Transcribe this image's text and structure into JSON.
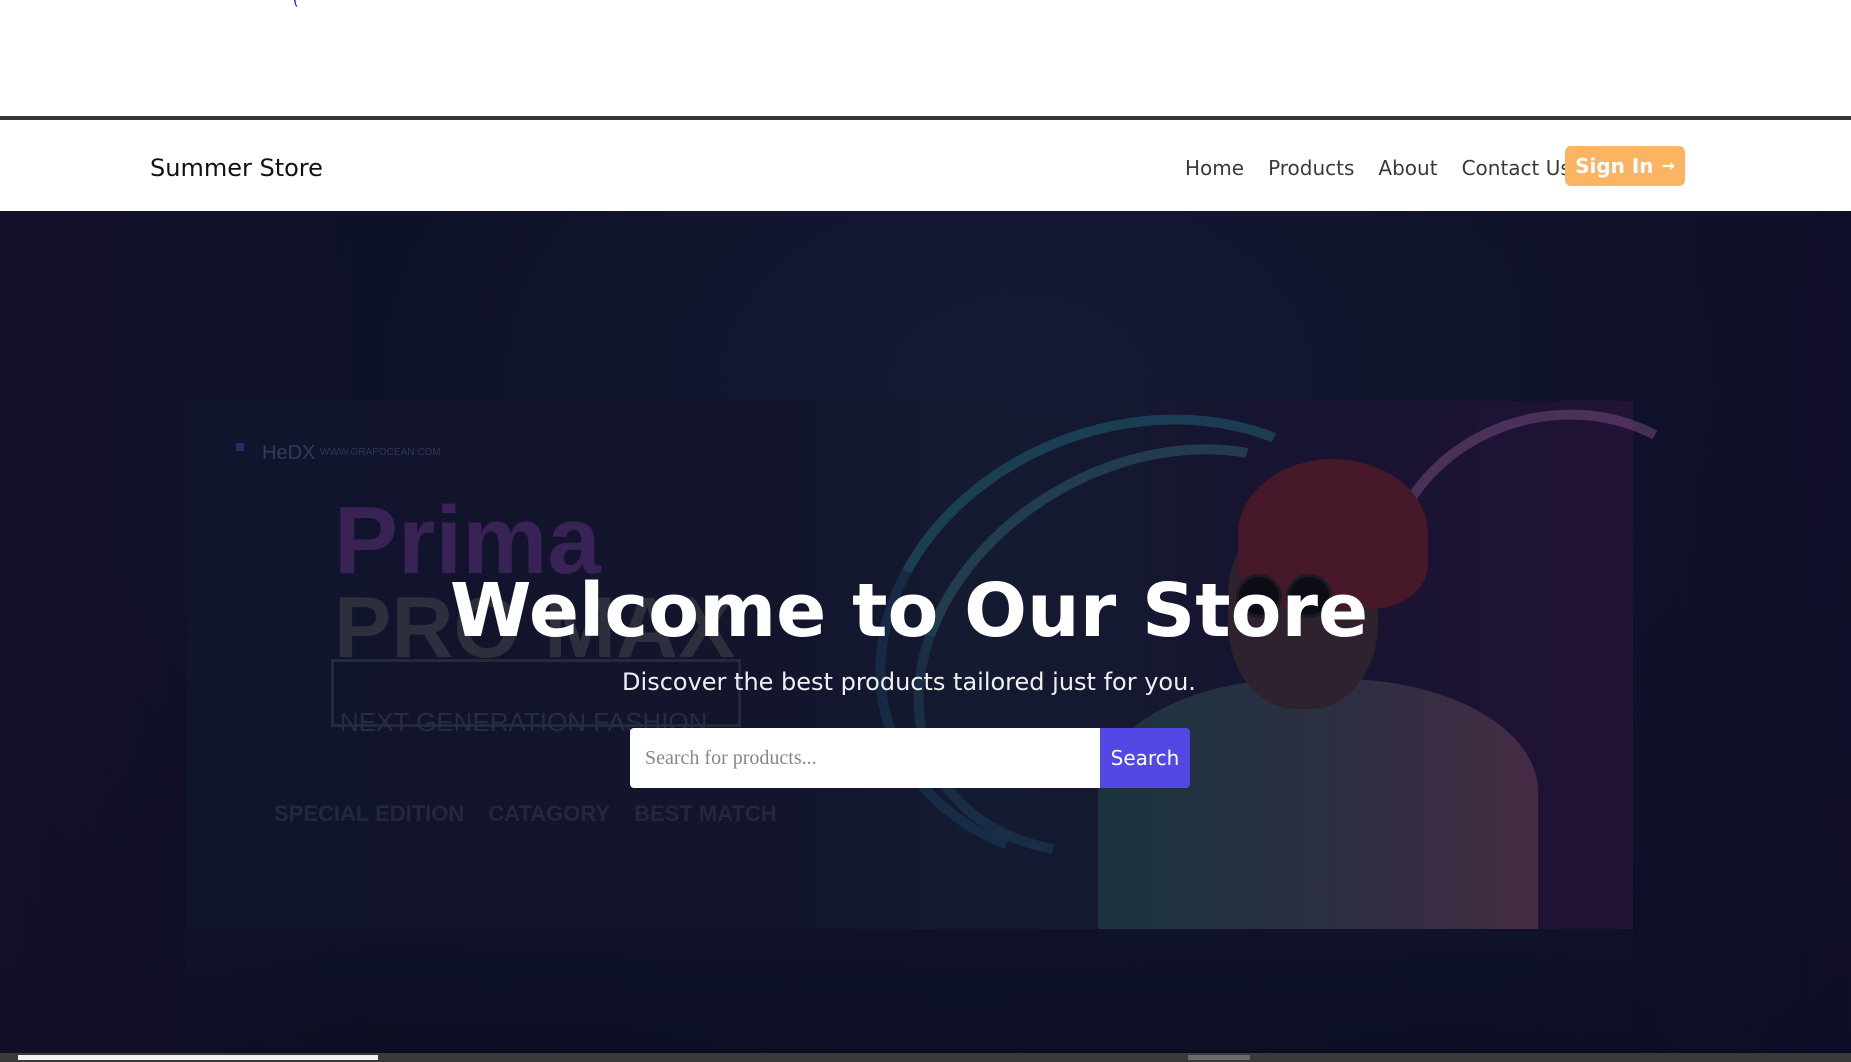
{
  "navbar": {
    "brand": "Summer Store",
    "links": [
      "Home",
      "Products",
      "About",
      "Contact Us"
    ],
    "signin_label": "Sign In",
    "signin_icon": "arrow-right-icon",
    "signin_color": "#fbb462"
  },
  "hero": {
    "title": "Welcome to Our Store",
    "subtitle": "Discover the best products tailored just for you.",
    "search_placeholder": "Search for products...",
    "search_value": "",
    "search_button": "Search",
    "search_button_color": "#5348e6"
  },
  "banner": {
    "logo": "HeDX",
    "url": "WWW.GRAPOCEAN.COM",
    "headline_1": "Prima",
    "headline_2": "PRO MAX",
    "tagline": "NEXT GENERATION FASHION",
    "tags": [
      "SPECIAL EDITION",
      "CATAGORY",
      "BEST MATCH"
    ]
  }
}
